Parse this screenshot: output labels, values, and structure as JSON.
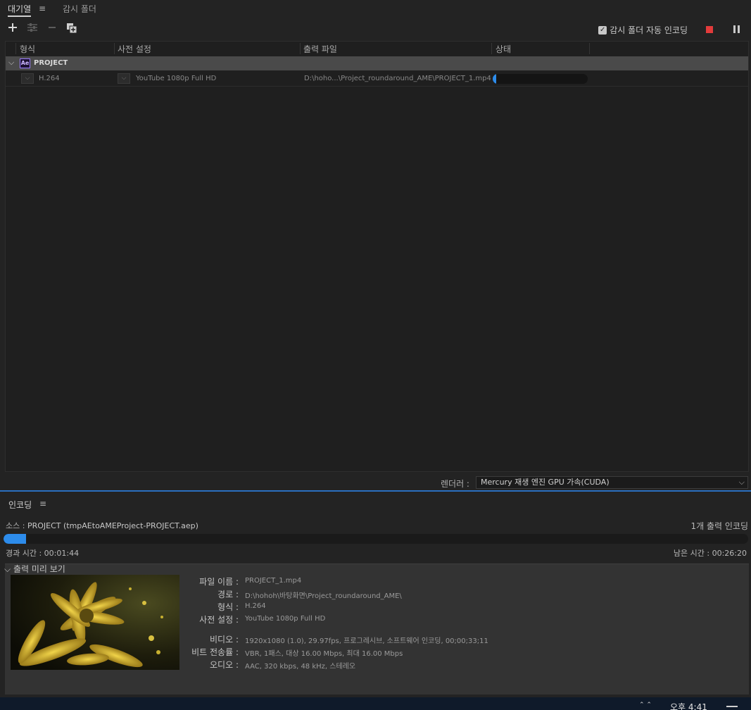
{
  "queue": {
    "tabs": [
      {
        "label": "대기열",
        "active": true
      },
      {
        "label": "감시 폴더",
        "active": false
      }
    ],
    "menu_icon": "≡",
    "toolbar": {
      "add_icon": "plus-icon",
      "settings_icon": "sliders-icon",
      "remove_icon": "minus-icon",
      "duplicate_icon": "duplicate-icon",
      "auto_encode_label": "감시 폴더 자동 인코딩",
      "auto_encode_checked": true,
      "stop_color": "#e33b3b"
    },
    "columns": [
      "형식",
      "사전 설정",
      "출력 파일",
      "상태"
    ],
    "group": {
      "app_badge": "Ae",
      "name": "PROJECT"
    },
    "items": [
      {
        "format": "H.264",
        "preset": "YouTube 1080p Full HD",
        "output": "D:\\hoho...\\Project_roundaround_AME\\PROJECT_1.mp4",
        "progress": 0.04
      }
    ],
    "renderer": {
      "label": "렌더러 :",
      "value": "Mercury 재생 엔진 GPU 가속(CUDA)"
    }
  },
  "encoding": {
    "tab_label": "인코딩",
    "source_label": "소스 :",
    "source_value": "PROJECT (tmpAEtoAMEProject-PROJECT.aep)",
    "output_count": "1개 출력 인코딩",
    "progress": 0.03,
    "elapsed": "경과 시간 : 00:01:44",
    "remaining": "남은 시간 : 00:26:20",
    "preview_label": "출력 미리 보기",
    "info": {
      "filename": {
        "key": "파일 이름 :",
        "value": "PROJECT_1.mp4"
      },
      "path": {
        "key": "경로 :",
        "value": "D:\\hohoh\\바탕화면\\Project_roundaround_AME\\"
      },
      "format": {
        "key": "형식 :",
        "value": "H.264"
      },
      "preset": {
        "key": "사전 설정 :",
        "value": "YouTube 1080p Full HD"
      },
      "video": {
        "key": "비디오 :",
        "value": "1920x1080 (1.0), 29.97fps, 프로그레시브, 소프트웨어 인코딩, 00;00;33;11"
      },
      "bitrate": {
        "key": "비트 전송률 :",
        "value": "VBR, 1패스, 대상 16.00 Mbps, 최대 16.00 Mbps"
      },
      "audio": {
        "key": "오디오 :",
        "value": "AAC, 320 kbps, 48 kHz, 스테레오"
      }
    }
  },
  "taskbar": {
    "clock": "오후 4:41",
    "accent": "#2d8ceb"
  }
}
